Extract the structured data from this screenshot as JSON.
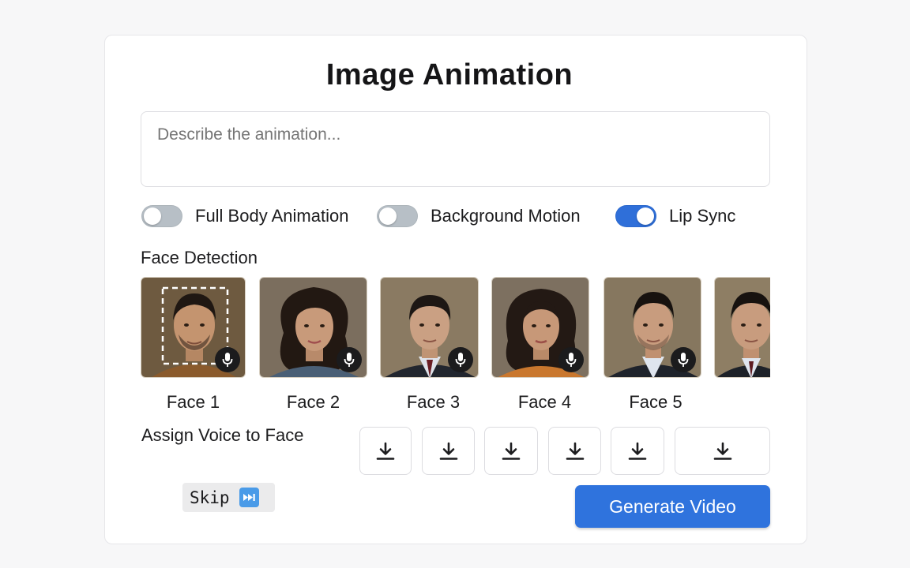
{
  "title": "Image Animation",
  "prompt": {
    "placeholder": "Describe the animation...",
    "value": ""
  },
  "toggles": [
    {
      "label": "Full Body Animation",
      "on": false
    },
    {
      "label": "Background Motion",
      "on": false
    },
    {
      "label": "Lip Sync",
      "on": true
    }
  ],
  "face_detection": {
    "label": "Face Detection",
    "faces": [
      {
        "label": "Face 1",
        "selected": true
      },
      {
        "label": "Face 2"
      },
      {
        "label": "Face 3"
      },
      {
        "label": "Face 4"
      },
      {
        "label": "Face 5"
      }
    ]
  },
  "assign_voice": {
    "label": "Assign Voice to Face"
  },
  "skip": {
    "label": "Skip"
  },
  "generate": {
    "label": "Generate Video"
  },
  "colors": {
    "accent": "#2f73dd",
    "toggle_off": "#b7bfc6",
    "skip_icon": "#4a9be8"
  }
}
